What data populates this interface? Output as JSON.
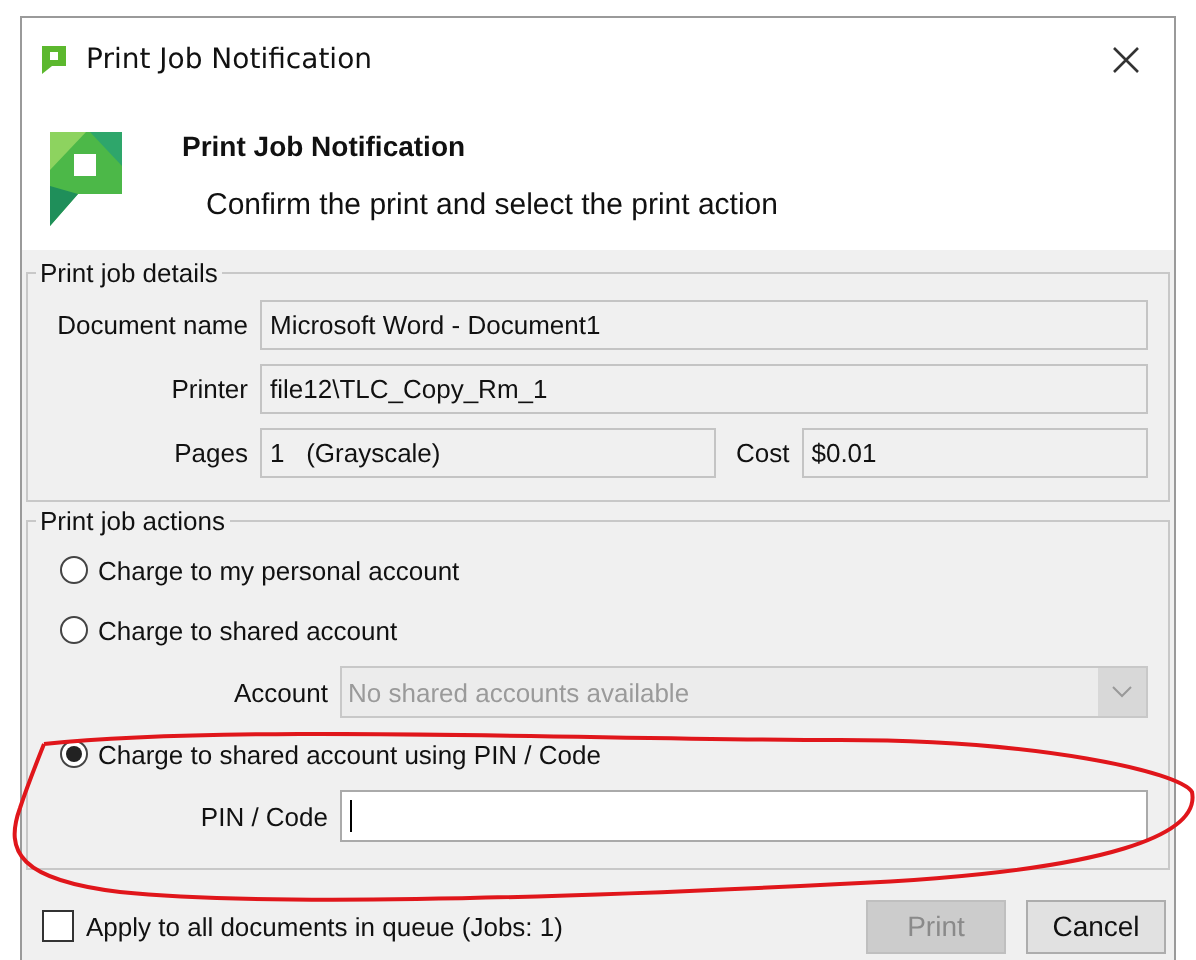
{
  "window": {
    "title": "Print Job Notification"
  },
  "header": {
    "title": "Print Job Notification",
    "message": "Confirm the print and select the print action"
  },
  "details": {
    "legend": "Print job details",
    "fields": [
      {
        "label": "Document name",
        "value": "Microsoft Word - Document1"
      },
      {
        "label": "Printer",
        "value": "file12\\TLC_Copy_Rm_1"
      }
    ],
    "pages": {
      "label": "Pages",
      "value": "1   (Grayscale)"
    },
    "cost": {
      "label": "Cost",
      "value": "$0.01"
    }
  },
  "actions": {
    "legend": "Print job actions",
    "options": [
      {
        "kind": "plain",
        "label": "Charge to my personal account",
        "selected": false
      },
      {
        "kind": "account",
        "label": "Charge to shared account",
        "selected": false,
        "field_label": "Account",
        "field_value": "No shared accounts available",
        "disabled": true
      },
      {
        "kind": "pin",
        "label": "Charge to shared account using PIN / Code",
        "selected": true,
        "field_label": "PIN / Code"
      }
    ]
  },
  "apply_all": {
    "label": "Apply to all documents in queue (Jobs: 1)",
    "checked": false
  },
  "buttons": [
    {
      "label": "Print",
      "disabled": true
    },
    {
      "label": "Cancel",
      "disabled": false
    }
  ]
}
